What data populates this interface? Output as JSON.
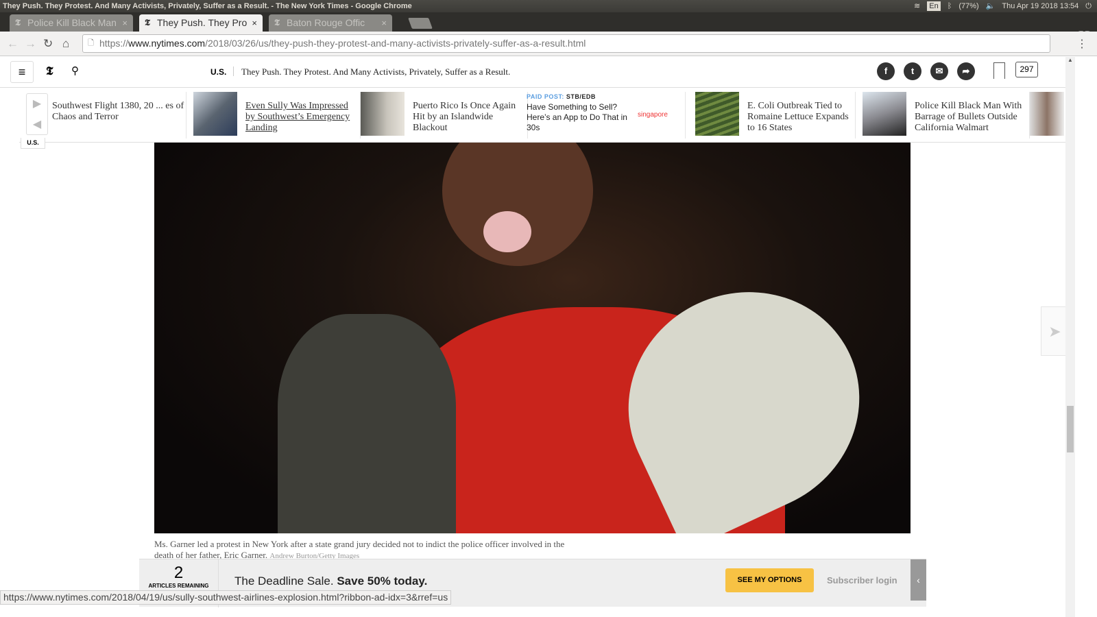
{
  "window": {
    "title": "They Push. They Protest. And Many Activists, Privately, Suffer as a Result. - The New York Times - Google Chrome"
  },
  "system": {
    "keyboard": "En",
    "battery": "(77%)",
    "datetime": "Thu Apr 19 2018 13:54"
  },
  "tabs": [
    {
      "label": "Police Kill Black Man"
    },
    {
      "label": "They Push. They Pro"
    },
    {
      "label": "Baton Rouge Offic"
    }
  ],
  "address": {
    "scheme": "https://",
    "domain": "www.nytimes.com",
    "path": "/2018/03/26/us/they-push-they-protest-and-many-activists-privately-suffer-as-a-result.html"
  },
  "header": {
    "section": "U.S.",
    "title": "They Push. They Protest. And Many Activists, Privately, Suffer as a Result.",
    "comments": "297"
  },
  "ribbon": {
    "items": [
      {
        "title": "Southwest Flight 1380, 20 ... es of Chaos and Terror"
      },
      {
        "title": "Even Sully Was Impressed by Southwest’s Emergency Landing"
      },
      {
        "title": "Puerto Rico Is Once Again Hit by an Islandwide Blackout"
      },
      {
        "label": "PAID POST:",
        "sponsor": "STB/EDB",
        "title": "Have Something to Sell? Here’s an App to Do That in 30s",
        "logo": "singapore"
      },
      {
        "title": "E. Coli Outbreak Tied to Romaine Lettuce Expands to 16 States"
      },
      {
        "title": "Police Kill Black Man With Barrage of Bullets Outside California Walmart"
      }
    ],
    "section_tag": "U.S."
  },
  "caption": {
    "text": "Ms. Garner led a protest in New York after a state grand jury decided not to indict the police officer involved in the death of her father, Eric Garner.",
    "credit": "Andrew Burton/Getty Images"
  },
  "gateway": {
    "count": "2",
    "count_label": "ARTICLES REMAINING",
    "offer": "The Deadline Sale.",
    "offer_bold": "Save 50% today.",
    "cta": "SEE MY OPTIONS",
    "login": "Subscriber login"
  },
  "status_url": "https://www.nytimes.com/2018/04/19/us/sully-southwest-airlines-explosion.html?ribbon-ad-idx=3&rref=us"
}
